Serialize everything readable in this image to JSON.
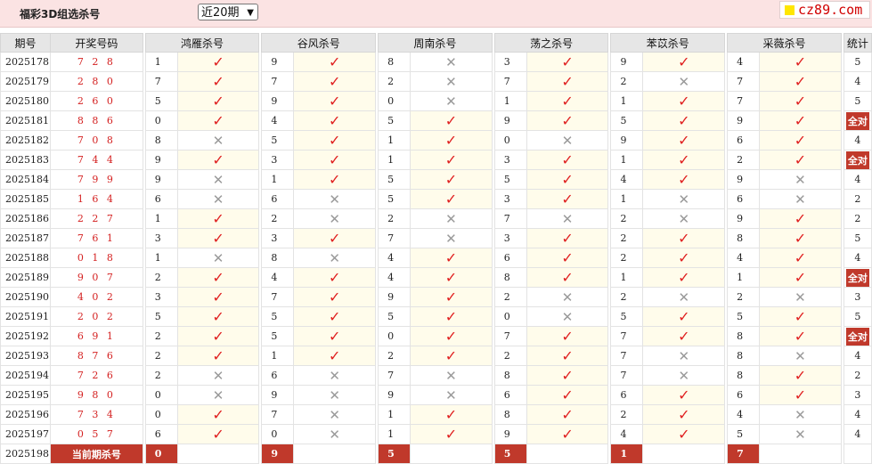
{
  "header": {
    "title": "福彩3D组选杀号",
    "period_select": "近20期",
    "logo_text": "cz89.com"
  },
  "columns": {
    "period": "期号",
    "draw": "开奖号码",
    "methods": [
      "鸿雁杀号",
      "谷风杀号",
      "周南杀号",
      "荡之杀号",
      "苯苡杀号",
      "采薇杀号"
    ],
    "stats": "统计"
  },
  "rows": [
    {
      "period": "2025178",
      "draw": "7 2 8",
      "k": [
        "1",
        "9",
        "8",
        "3",
        "9",
        "4"
      ],
      "ok": [
        1,
        1,
        0,
        1,
        1,
        1
      ],
      "stat": "5"
    },
    {
      "period": "2025179",
      "draw": "2 8 0",
      "k": [
        "7",
        "7",
        "2",
        "7",
        "2",
        "7"
      ],
      "ok": [
        1,
        1,
        0,
        1,
        0,
        1
      ],
      "stat": "4"
    },
    {
      "period": "2025180",
      "draw": "2 6 0",
      "k": [
        "5",
        "9",
        "0",
        "1",
        "1",
        "7"
      ],
      "ok": [
        1,
        1,
        0,
        1,
        1,
        1
      ],
      "stat": "5"
    },
    {
      "period": "2025181",
      "draw": "8 8 6",
      "k": [
        "0",
        "4",
        "5",
        "9",
        "5",
        "9"
      ],
      "ok": [
        1,
        1,
        1,
        1,
        1,
        1
      ],
      "stat": "全对"
    },
    {
      "period": "2025182",
      "draw": "7 0 8",
      "k": [
        "8",
        "5",
        "1",
        "0",
        "9",
        "6"
      ],
      "ok": [
        0,
        1,
        1,
        0,
        1,
        1
      ],
      "stat": "4"
    },
    {
      "period": "2025183",
      "draw": "7 4 4",
      "k": [
        "9",
        "3",
        "1",
        "3",
        "1",
        "2"
      ],
      "ok": [
        1,
        1,
        1,
        1,
        1,
        1
      ],
      "stat": "全对"
    },
    {
      "period": "2025184",
      "draw": "7 9 9",
      "k": [
        "9",
        "1",
        "5",
        "5",
        "4",
        "9"
      ],
      "ok": [
        0,
        1,
        1,
        1,
        1,
        0
      ],
      "stat": "4"
    },
    {
      "period": "2025185",
      "draw": "1 6 4",
      "k": [
        "6",
        "6",
        "5",
        "3",
        "1",
        "6"
      ],
      "ok": [
        0,
        0,
        1,
        1,
        0,
        0
      ],
      "stat": "2"
    },
    {
      "period": "2025186",
      "draw": "2 2 7",
      "k": [
        "1",
        "2",
        "2",
        "7",
        "2",
        "9"
      ],
      "ok": [
        1,
        0,
        0,
        0,
        0,
        1
      ],
      "stat": "2"
    },
    {
      "period": "2025187",
      "draw": "7 6 1",
      "k": [
        "3",
        "3",
        "7",
        "3",
        "2",
        "8"
      ],
      "ok": [
        1,
        1,
        0,
        1,
        1,
        1
      ],
      "stat": "5"
    },
    {
      "period": "2025188",
      "draw": "0 1 8",
      "k": [
        "1",
        "8",
        "4",
        "6",
        "2",
        "4"
      ],
      "ok": [
        0,
        0,
        1,
        1,
        1,
        1
      ],
      "stat": "4"
    },
    {
      "period": "2025189",
      "draw": "9 0 7",
      "k": [
        "2",
        "4",
        "4",
        "8",
        "1",
        "1"
      ],
      "ok": [
        1,
        1,
        1,
        1,
        1,
        1
      ],
      "stat": "全对"
    },
    {
      "period": "2025190",
      "draw": "4 0 2",
      "k": [
        "3",
        "7",
        "9",
        "2",
        "2",
        "2"
      ],
      "ok": [
        1,
        1,
        1,
        0,
        0,
        0
      ],
      "stat": "3"
    },
    {
      "period": "2025191",
      "draw": "2 0 2",
      "k": [
        "5",
        "5",
        "5",
        "0",
        "5",
        "5"
      ],
      "ok": [
        1,
        1,
        1,
        0,
        1,
        1
      ],
      "stat": "5"
    },
    {
      "period": "2025192",
      "draw": "6 9 1",
      "k": [
        "2",
        "5",
        "0",
        "7",
        "7",
        "8"
      ],
      "ok": [
        1,
        1,
        1,
        1,
        1,
        1
      ],
      "stat": "全对"
    },
    {
      "period": "2025193",
      "draw": "8 7 6",
      "k": [
        "2",
        "1",
        "2",
        "2",
        "7",
        "8"
      ],
      "ok": [
        1,
        1,
        1,
        1,
        0,
        0
      ],
      "stat": "4"
    },
    {
      "period": "2025194",
      "draw": "7 2 6",
      "k": [
        "2",
        "6",
        "7",
        "8",
        "7",
        "8"
      ],
      "ok": [
        0,
        0,
        0,
        1,
        0,
        1
      ],
      "stat": "2"
    },
    {
      "period": "2025195",
      "draw": "9 8 0",
      "k": [
        "0",
        "9",
        "9",
        "6",
        "6",
        "6"
      ],
      "ok": [
        0,
        0,
        0,
        1,
        1,
        1
      ],
      "stat": "3"
    },
    {
      "period": "2025196",
      "draw": "7 3 4",
      "k": [
        "0",
        "7",
        "1",
        "8",
        "2",
        "4"
      ],
      "ok": [
        1,
        0,
        1,
        1,
        1,
        0
      ],
      "stat": "4"
    },
    {
      "period": "2025197",
      "draw": "0 5 7",
      "k": [
        "6",
        "0",
        "1",
        "9",
        "4",
        "5"
      ],
      "ok": [
        1,
        0,
        1,
        1,
        1,
        0
      ],
      "stat": "4"
    }
  ],
  "current": {
    "period": "2025198",
    "label": "当前期杀号",
    "k": [
      "0",
      "9",
      "5",
      "5",
      "1",
      "7"
    ]
  },
  "marks": {
    "ok": "✓",
    "no": "✕"
  },
  "colors": {
    "accent": "#c0392b",
    "header_bg": "#fbe3e3",
    "highlight_bg": "#fffceb"
  }
}
